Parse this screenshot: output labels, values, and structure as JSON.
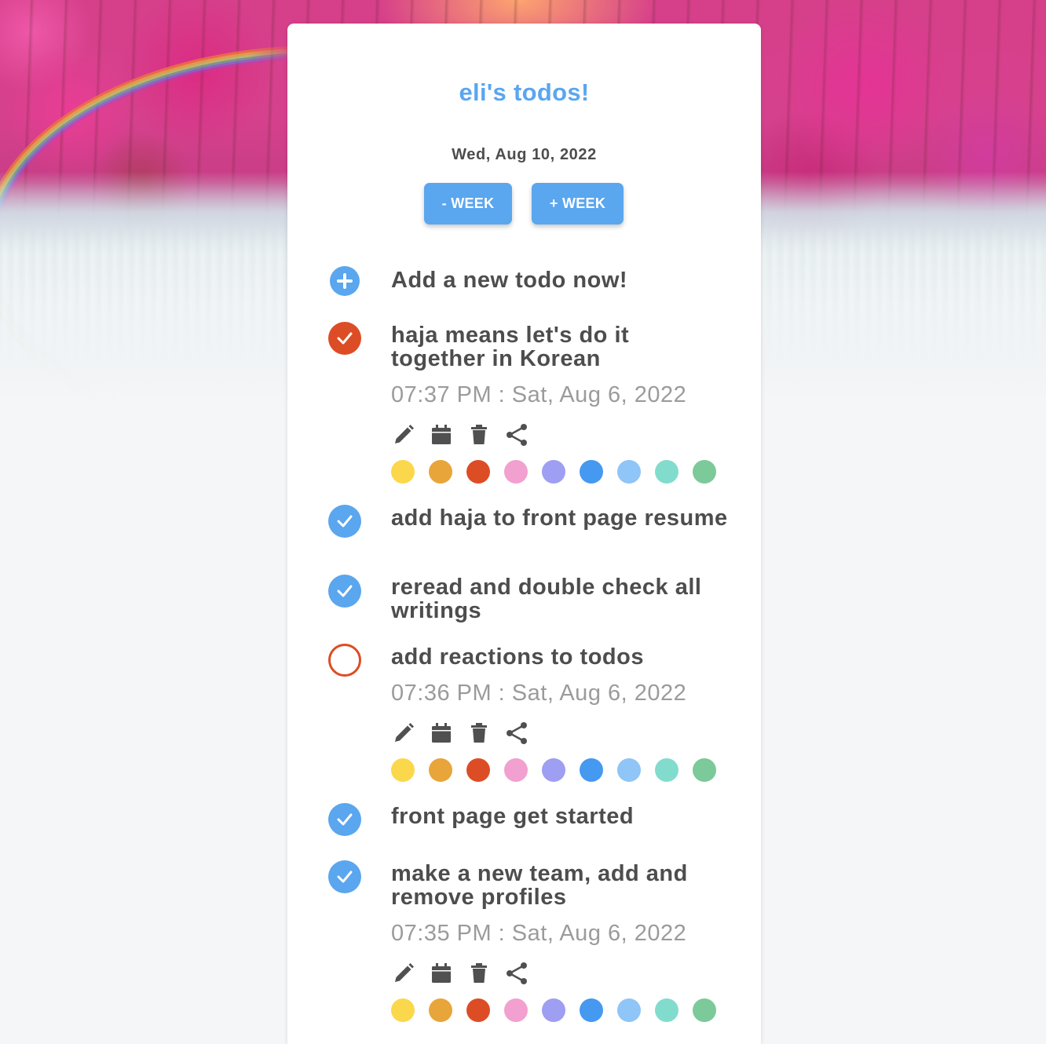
{
  "app": {
    "title": "eli's todos!",
    "date": "Wed, Aug 10, 2022"
  },
  "nav": {
    "prev_week_label": "- WEEK",
    "next_week_label": "+ WEEK"
  },
  "add_todo": {
    "label": "Add a new todo now!",
    "icon": "plus-circle-icon"
  },
  "todos": [
    {
      "text": "haja means let's do it together in Korean",
      "status": "done",
      "check_color": "#dd4d25",
      "timestamp": "07:37 PM : Sat, Aug 6, 2022",
      "expanded": true
    },
    {
      "text": "add haja to front page resume",
      "status": "done",
      "check_color": "#5aa6ef",
      "expanded": false
    },
    {
      "text": "reread and double check all writings",
      "status": "done",
      "check_color": "#5aa6ef",
      "expanded": false
    },
    {
      "text": "add reactions to todos",
      "status": "open",
      "check_color": "#dd4d25",
      "timestamp": "07:36 PM : Sat, Aug 6, 2022",
      "expanded": true
    },
    {
      "text": "front page get started",
      "status": "done",
      "check_color": "#5aa6ef",
      "expanded": false
    },
    {
      "text": "make a new team, add and remove profiles",
      "status": "done",
      "check_color": "#5aa6ef",
      "timestamp": "07:35 PM : Sat, Aug 6, 2022",
      "expanded": true
    }
  ],
  "action_icons": [
    "pencil-icon",
    "calendar-icon",
    "trash-icon",
    "share-icon"
  ],
  "palette": [
    "#fbd74b",
    "#e8a53a",
    "#dd4d25",
    "#f1a0cf",
    "#9e9ef2",
    "#4599f0",
    "#8fc5f7",
    "#82dccd",
    "#7cc99a"
  ],
  "colors": {
    "accent": "#5aa6ef",
    "danger": "#dd4d25",
    "text": "#4d4d4d",
    "muted": "#9b9b9b"
  }
}
